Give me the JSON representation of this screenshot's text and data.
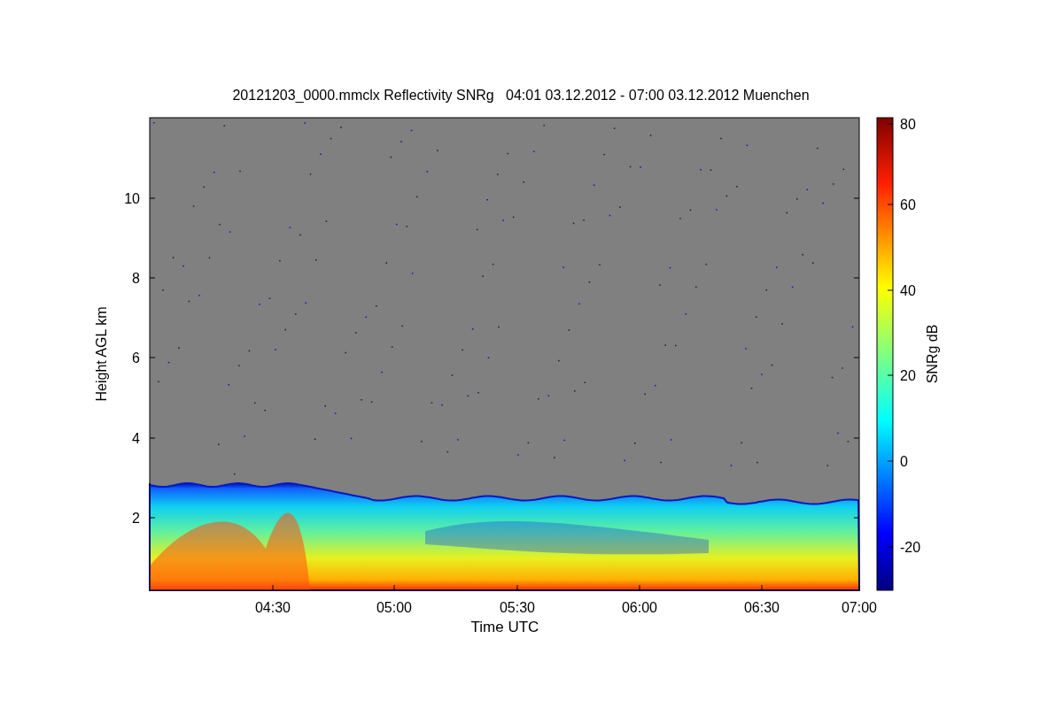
{
  "figure": {
    "title": "20121203_0000.mmclx Reflectivity SNRg   04:01 03.12.2012 - 07:00 03.12.2012 Muenchen",
    "xlabel": "Time UTC",
    "ylabel": "Height AGL km",
    "xticks": [
      "04:30",
      "05:00",
      "05:30",
      "06:00",
      "06:30",
      "07:00"
    ],
    "yticks": [
      "10",
      "8",
      "6",
      "4",
      "2"
    ],
    "colorbar": {
      "label": "SNRg dB",
      "ticks": [
        "80",
        "60",
        "40",
        "20",
        "0",
        "-20"
      ]
    }
  }
}
